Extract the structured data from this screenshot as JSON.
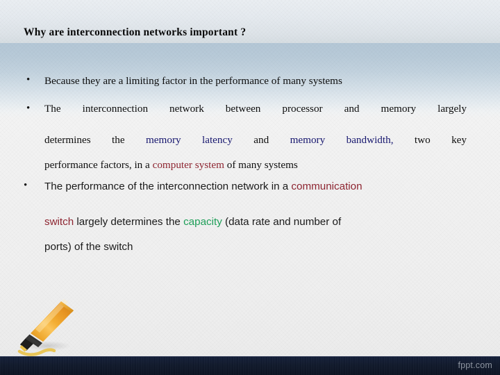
{
  "slide": {
    "title": "Why are interconnection networks important ?",
    "bullet_marker": "•",
    "watermark": "fppt.com"
  },
  "colors": {
    "title_text": "#0a0a0a",
    "body_text": "#0d0d0d",
    "highlight_blue": "#16166e",
    "highlight_red": "#8d2430",
    "highlight_green": "#1e9e58",
    "header_band_blue": "#b4c7d6",
    "header_top": "#eaeef2",
    "body_background": "#f2f2f2",
    "footer_navy": "#111a2c",
    "marker_body_orange": "#efa32e",
    "marker_ink_yellow": "#e8c24a",
    "watermark_text": "#8d94a0"
  },
  "bullets": [
    {
      "id": "bullet-1",
      "font": "serif",
      "lines": [
        {
          "segments": [
            {
              "text": "Because they are a limiting factor in the performance of many systems",
              "color": "default"
            }
          ]
        }
      ]
    },
    {
      "id": "bullet-2",
      "font": "serif",
      "lines": [
        {
          "segments": [
            {
              "text": "The interconnection network between processor and memory largely",
              "color": "default"
            }
          ]
        },
        {
          "segments": [
            {
              "text": "determines the ",
              "color": "default"
            },
            {
              "text": "memory latency",
              "color": "blue"
            },
            {
              "text": " and ",
              "color": "default"
            },
            {
              "text": "memory",
              "color": "blue"
            },
            {
              "text": "  ",
              "color": "default"
            },
            {
              "text": "bandwidth,",
              "color": "blue"
            },
            {
              "text": " two key",
              "color": "default"
            }
          ]
        },
        {
          "segments": [
            {
              "text": "performance factors, in a ",
              "color": "default"
            },
            {
              "text": "computer system",
              "color": "red"
            },
            {
              "text": " of many systems",
              "color": "default"
            }
          ]
        }
      ]
    },
    {
      "id": "bullet-3",
      "font": "sans",
      "lines": [
        {
          "segments": [
            {
              "text": "The performance of the interconnection network in a ",
              "color": "default"
            },
            {
              "text": "communication",
              "color": "red"
            }
          ]
        },
        {
          "segments": [
            {
              "text": "switch",
              "color": "red"
            },
            {
              "text": " largely determines the ",
              "color": "default"
            },
            {
              "text": "capacity",
              "color": "green"
            },
            {
              "text": " (data rate and number of",
              "color": "default"
            }
          ]
        },
        {
          "segments": [
            {
              "text": "ports) of the switch",
              "color": "default"
            }
          ]
        }
      ]
    }
  ],
  "text": {
    "b1_line1": "Because they are a limiting factor in the performance of many systems",
    "b2_line1": "The interconnection network between processor and memory largely",
    "b2_l2_a": "determines",
    "b2_l2_b": "the",
    "b2_l2_c": "memory",
    "b2_l2_d": "latency",
    "b2_l2_e": "and",
    "b2_l2_f": "memory",
    "b2_l2_g": "bandwidth,",
    "b2_l2_h": "two",
    "b2_l2_i": "key",
    "b2_l3_a": "performance factors, in a ",
    "b2_l3_b": "computer system",
    "b2_l3_c": " of many systems",
    "b3_l1_a": "The performance of the interconnection network in a ",
    "b3_l1_b": "communication",
    "b3_l2_a": "switch",
    "b3_l2_b": " largely determines the ",
    "b3_l2_c": "capacity",
    "b3_l2_d": " (data rate and number of",
    "b3_l3_a": "ports) of the switch"
  }
}
